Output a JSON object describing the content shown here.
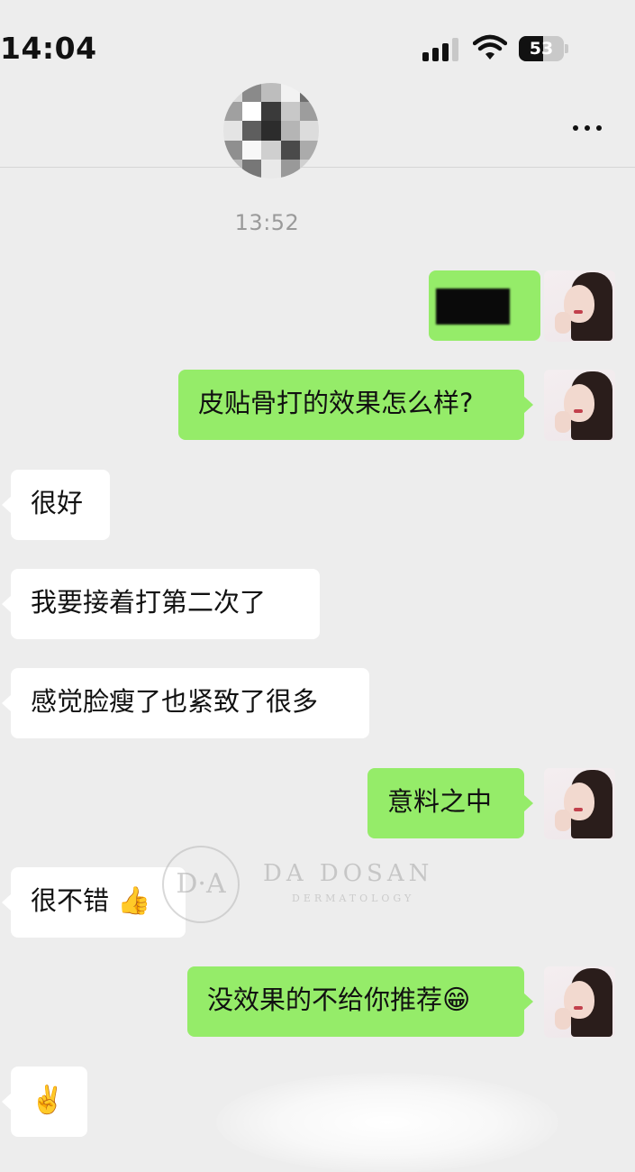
{
  "status_bar": {
    "time": "14:04",
    "battery_level": "53",
    "battery_fraction": 0.53,
    "icons": [
      "cellular-signal-icon",
      "wifi-icon",
      "battery-icon"
    ]
  },
  "nav": {
    "more_icon": "more-dots-icon"
  },
  "chat": {
    "timestamp": "13:52",
    "messages": [
      {
        "side": "sent",
        "text": "",
        "redacted": true
      },
      {
        "side": "sent",
        "text": "皮贴骨打的效果怎么样?"
      },
      {
        "side": "recv",
        "text": "很好"
      },
      {
        "side": "recv",
        "text": "我要接着打第二次了"
      },
      {
        "side": "recv",
        "text": "感觉脸瘦了也紧致了很多"
      },
      {
        "side": "sent",
        "text": "意料之中"
      },
      {
        "side": "recv",
        "text": "很不错",
        "emoji": "👍"
      },
      {
        "side": "sent",
        "text": "没效果的不给你推荐",
        "emoji": "😁"
      },
      {
        "side": "recv",
        "text": "",
        "emoji": "✌️"
      }
    ]
  },
  "watermark": {
    "logo": "D·A",
    "title": "DA DOSAN",
    "subtitle": "DERMATOLOGY"
  },
  "colors": {
    "background": "#ededed",
    "sent_bubble": "#95ec69",
    "received_bubble": "#ffffff",
    "timestamp": "#9a9a9a"
  }
}
